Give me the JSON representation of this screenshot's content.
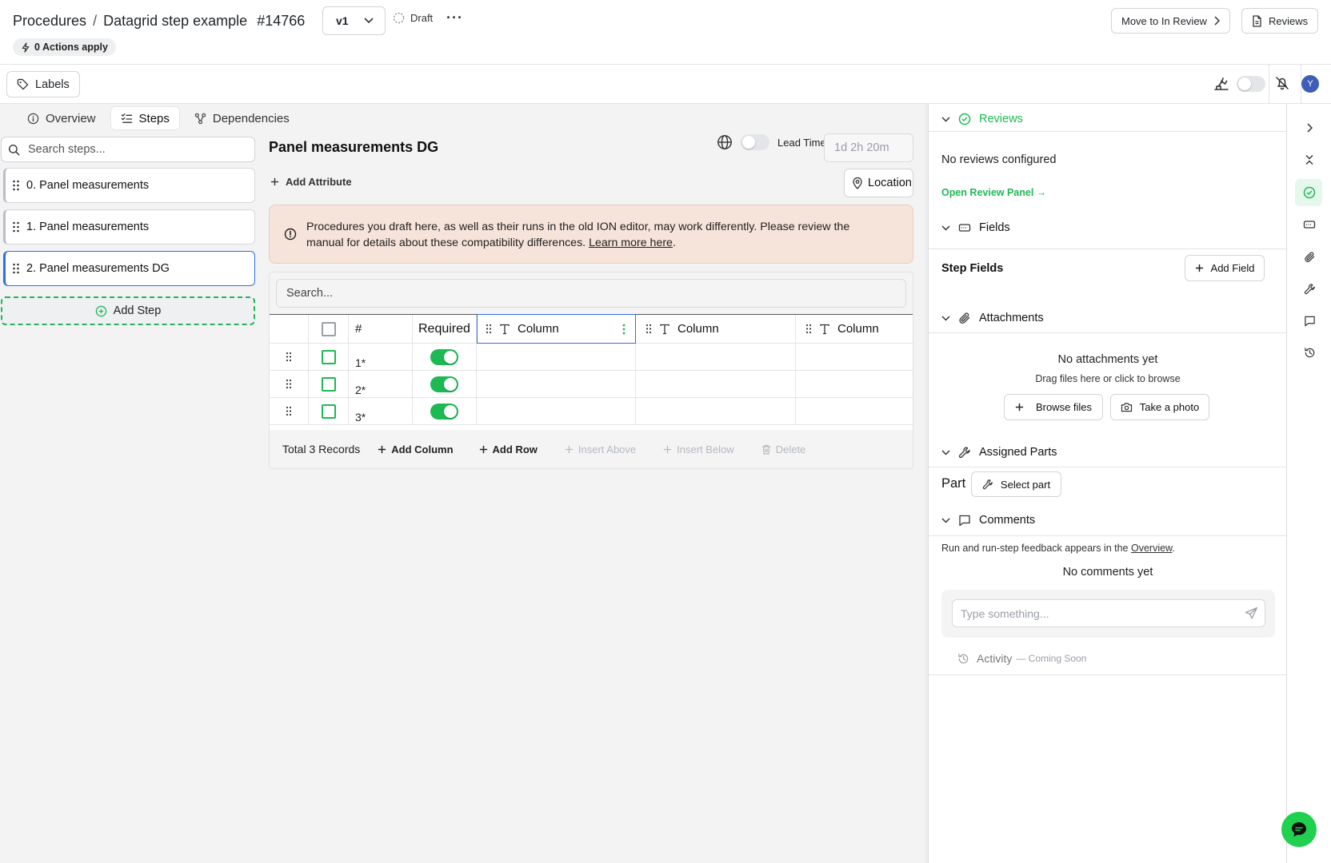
{
  "header": {
    "breadcrumb_root": "Procedures",
    "breadcrumb_sep": "/",
    "title": "Datagrid step example",
    "number": "#14766",
    "version": "v1",
    "status": "Draft",
    "more": "···",
    "actions_apply": "0 Actions apply",
    "move_button": "Move to In Review",
    "reviews_button": "Reviews"
  },
  "toolbar": {
    "labels_button": "Labels",
    "avatar_initial": "Y"
  },
  "tabs": [
    {
      "label": "Overview",
      "icon": "info-icon",
      "active": false
    },
    {
      "label": "Steps",
      "icon": "list-checks-icon",
      "active": true
    },
    {
      "label": "Dependencies",
      "icon": "graph-icon",
      "active": false
    }
  ],
  "steps_panel": {
    "search_placeholder": "Search steps...",
    "steps": [
      {
        "label": "0. Panel measurements",
        "selected": false
      },
      {
        "label": "1. Panel measurements",
        "selected": false
      },
      {
        "label": "2. Panel measurements DG",
        "selected": true
      }
    ],
    "add_step": "Add Step"
  },
  "step": {
    "title": "Panel measurements DG",
    "lead_time_label": "Lead Time",
    "lead_time_placeholder": "1d 2h 20m",
    "add_attribute": "Add Attribute",
    "location_button": "Location",
    "notice_text": "Procedures you draft here, as well as their runs in the old ION editor, may work differently. Please review the manual for details about these compatibility differences.",
    "notice_link": "Learn more here",
    "notice_end": "."
  },
  "datagrid": {
    "search_placeholder": "Search...",
    "headers": {
      "number": "#",
      "required": "Required",
      "columns": [
        "Column",
        "Column",
        "Column"
      ]
    },
    "rows": [
      {
        "num": "1*",
        "required": true
      },
      {
        "num": "2*",
        "required": true
      },
      {
        "num": "3*",
        "required": true
      }
    ],
    "footer": {
      "total": "Total 3 Records",
      "add_column": "Add Column",
      "add_row": "Add Row",
      "insert_above": "Insert Above",
      "insert_below": "Insert Below",
      "delete": "Delete"
    }
  },
  "right_panel": {
    "reviews_title": "Reviews",
    "no_reviews": "No reviews configured",
    "open_review_panel": "Open Review Panel →",
    "fields_title": "Fields",
    "step_fields": "Step Fields",
    "add_field": "Add Field",
    "attachments_title": "Attachments",
    "no_attachments": "No attachments yet",
    "drag_hint": "Drag files here or click to browse",
    "browse_files": "Browse files",
    "take_photo": "Take a photo",
    "assigned_parts_title": "Assigned Parts",
    "part_label": "Part",
    "select_part": "Select part",
    "comments_title": "Comments",
    "comments_hint": "Run and run-step feedback appears in the",
    "comments_hint_link": "Overview",
    "comments_hint_end": ".",
    "no_comments": "No comments yet",
    "comment_placeholder": "Type something...",
    "activity": "Activity",
    "activity_suffix": "— Coming Soon"
  },
  "colors": {
    "accent_green": "#1db954",
    "selection_blue": "#2f6fe4",
    "notice_bg": "#f6e3da"
  }
}
